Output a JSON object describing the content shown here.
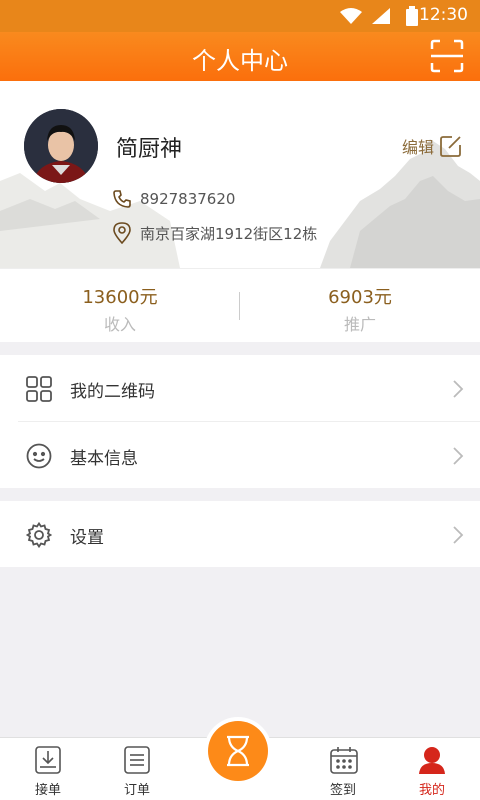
{
  "status_bar": {
    "time": "12:30",
    "icons": [
      "wifi-icon",
      "signal-icon",
      "battery-icon"
    ]
  },
  "header": {
    "title": "个人中心",
    "scan_icon": "scan-icon"
  },
  "profile": {
    "name": "简厨神",
    "edit_label": "编辑",
    "phone": "8927837620",
    "address": "南京百家湖1912街区12栋"
  },
  "stats": [
    {
      "value": "13600元",
      "label": "收入"
    },
    {
      "value": "6903元",
      "label": "推广"
    }
  ],
  "menu": {
    "group1": [
      {
        "label": "我的二维码",
        "icon": "qrcode-icon"
      },
      {
        "label": "基本信息",
        "icon": "smiley-icon"
      }
    ],
    "group2": [
      {
        "label": "设置",
        "icon": "gear-icon"
      }
    ]
  },
  "tabs": [
    {
      "label": "接单",
      "icon": "download-tray-icon"
    },
    {
      "label": "订单",
      "icon": "order-list-icon"
    },
    {
      "label": "",
      "icon": "hourglass-icon"
    },
    {
      "label": "签到",
      "icon": "calendar-icon"
    },
    {
      "label": "我的",
      "icon": "user-icon"
    }
  ],
  "colors": {
    "accent": "#fb7a12",
    "brown": "#8b5f1e",
    "active_tab": "#d5261b"
  }
}
